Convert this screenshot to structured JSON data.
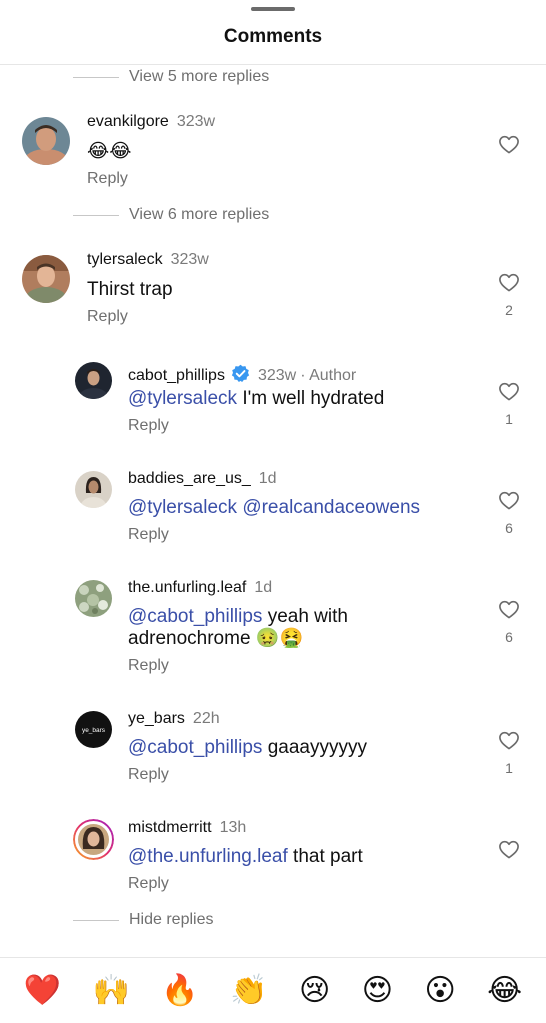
{
  "header": {
    "title": "Comments"
  },
  "threads": {
    "view_more_1": "View 5 more replies",
    "view_more_2": "View 6 more replies",
    "hide_replies": "Hide replies"
  },
  "comments": [
    {
      "username": "evankilgore",
      "time": "323w",
      "text": "😂😂",
      "reply": "Reply",
      "likes": ""
    },
    {
      "username": "tylersaleck",
      "time": "323w",
      "text": "Thirst trap",
      "reply": "Reply",
      "likes": "2"
    }
  ],
  "replies": [
    {
      "username": "cabot_phillips",
      "time": "323w",
      "author_tag": "· Author",
      "mention": "@tylersaleck",
      "text": " I'm well hydrated",
      "reply": "Reply",
      "likes": "1"
    },
    {
      "username": "baddies_are_us_",
      "time": "1d",
      "mention": "@tylersaleck @realcandaceowens",
      "text": "",
      "reply": "Reply",
      "likes": "6"
    },
    {
      "username": "the.unfurling.leaf",
      "time": "1d",
      "mention": "@cabot_phillips",
      "text": " yeah with",
      "text2": "adrenochrome 🤢🤮",
      "reply": "Reply",
      "likes": "6"
    },
    {
      "username": "ye_bars",
      "time": "22h",
      "mention": "@cabot_phillips",
      "text": " gaaayyyyyy",
      "reply": "Reply",
      "likes": "1",
      "avatar_text": "ye_bars"
    },
    {
      "username": "mistdmerritt",
      "time": "13h",
      "mention": "@the.unfurling.leaf",
      "text": " that part",
      "reply": "Reply",
      "likes": ""
    }
  ],
  "reactions": [
    "❤️",
    "🙌",
    "🔥",
    "👏",
    "😢",
    "😍",
    "😮",
    "😂"
  ],
  "colors": {
    "mention": "#3a4fa8",
    "verified": "#3897f0",
    "muted": "#6f6f6f"
  },
  "icons": {
    "like": "heart-outline-icon",
    "verified": "verified-badge-icon"
  }
}
